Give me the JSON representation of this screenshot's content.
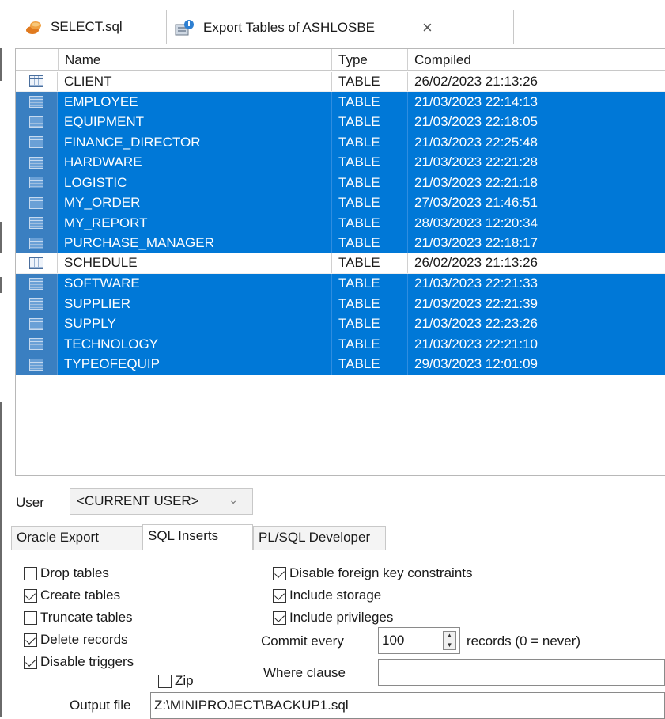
{
  "tabs": [
    {
      "label": "SELECT.sql",
      "icon": "sql-file-icon",
      "active": false
    },
    {
      "label": "Export Tables of ASHLOSBE",
      "icon": "export-tables-icon",
      "active": true,
      "close": "×"
    }
  ],
  "grid": {
    "columns": [
      "Name",
      "Type",
      "Compiled"
    ],
    "rows": [
      {
        "name": "CLIENT",
        "type": "TABLE",
        "compiled": "26/02/2023 21:13:26",
        "selected": false
      },
      {
        "name": "EMPLOYEE",
        "type": "TABLE",
        "compiled": "21/03/2023 22:14:13",
        "selected": true
      },
      {
        "name": "EQUIPMENT",
        "type": "TABLE",
        "compiled": "21/03/2023 22:18:05",
        "selected": true
      },
      {
        "name": "FINANCE_DIRECTOR",
        "type": "TABLE",
        "compiled": "21/03/2023 22:25:48",
        "selected": true
      },
      {
        "name": "HARDWARE",
        "type": "TABLE",
        "compiled": "21/03/2023 22:21:28",
        "selected": true
      },
      {
        "name": "LOGISTIC",
        "type": "TABLE",
        "compiled": "21/03/2023 22:21:18",
        "selected": true
      },
      {
        "name": "MY_ORDER",
        "type": "TABLE",
        "compiled": "27/03/2023 21:46:51",
        "selected": true
      },
      {
        "name": "MY_REPORT",
        "type": "TABLE",
        "compiled": "28/03/2023 12:20:34",
        "selected": true
      },
      {
        "name": "PURCHASE_MANAGER",
        "type": "TABLE",
        "compiled": "21/03/2023 22:18:17",
        "selected": true
      },
      {
        "name": "SCHEDULE",
        "type": "TABLE",
        "compiled": "26/02/2023 21:13:26",
        "selected": false
      },
      {
        "name": "SOFTWARE",
        "type": "TABLE",
        "compiled": "21/03/2023 22:21:33",
        "selected": true
      },
      {
        "name": "SUPPLIER",
        "type": "TABLE",
        "compiled": "21/03/2023 22:21:39",
        "selected": true
      },
      {
        "name": "SUPPLY",
        "type": "TABLE",
        "compiled": "21/03/2023 22:23:26",
        "selected": true
      },
      {
        "name": "TECHNOLOGY",
        "type": "TABLE",
        "compiled": "21/03/2023 22:21:10",
        "selected": true
      },
      {
        "name": "TYPEOFEQUIP",
        "type": "TABLE",
        "compiled": "29/03/2023 12:01:09",
        "selected": true
      }
    ]
  },
  "user": {
    "label": "User",
    "value": "<CURRENT USER>"
  },
  "subtabs": [
    "Oracle Export",
    "SQL Inserts",
    "PL/SQL Developer"
  ],
  "active_subtab": "SQL Inserts",
  "options": {
    "left": [
      {
        "label": "Drop tables",
        "checked": false
      },
      {
        "label": "Create tables",
        "checked": true
      },
      {
        "label": "Truncate tables",
        "checked": false
      },
      {
        "label": "Delete records",
        "checked": true
      },
      {
        "label": "Disable triggers",
        "checked": true
      }
    ],
    "right": [
      {
        "label": "Disable foreign key constraints",
        "checked": true
      },
      {
        "label": "Include storage",
        "checked": true
      },
      {
        "label": "Include privileges",
        "checked": true
      }
    ],
    "zip": {
      "label": "Zip",
      "checked": false
    },
    "commit_every": {
      "label": "Commit every",
      "value": "100",
      "suffix": "records (0 = never)"
    },
    "where_clause": {
      "label": "Where clause",
      "value": ""
    },
    "output_file": {
      "label": "Output file",
      "value": "Z:\\MINIPROJECT\\BACKUP1.sql"
    }
  },
  "colors": {
    "selection": "#0078d7",
    "border": "#c8c8c8"
  }
}
